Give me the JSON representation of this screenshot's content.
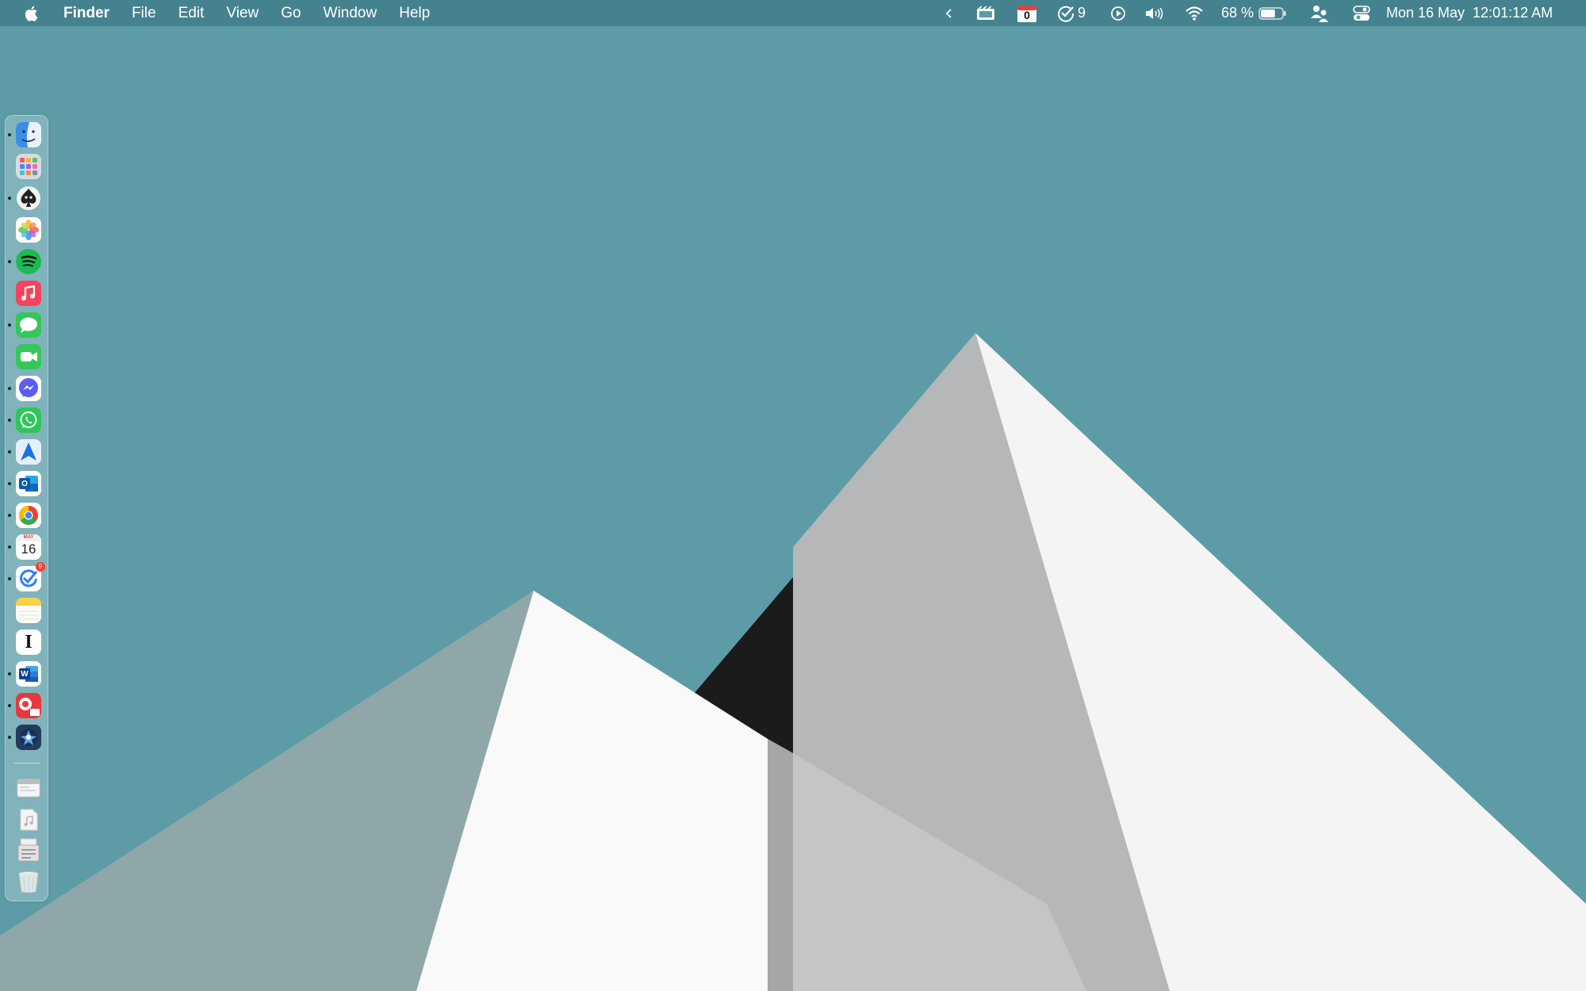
{
  "menubar": {
    "app_name": "Finder",
    "menus": [
      "File",
      "Edit",
      "View",
      "Go",
      "Window",
      "Help"
    ],
    "status": {
      "calendar_badge": "0",
      "reminders_count": "9",
      "battery_percent": "68 %",
      "battery_level": 0.68,
      "date": "Mon 16 May",
      "time": "12:01:12 AM"
    }
  },
  "dock": {
    "apps": [
      {
        "name": "Finder",
        "icon": "finder-icon",
        "running": true
      },
      {
        "name": "Launchpad",
        "icon": "launchpad-icon",
        "running": false
      },
      {
        "name": "Spades",
        "icon": "spade-icon",
        "running": true
      },
      {
        "name": "Photos",
        "icon": "photos-icon",
        "running": false
      },
      {
        "name": "Spotify",
        "icon": "spotify-icon",
        "running": true
      },
      {
        "name": "Music",
        "icon": "music-icon",
        "running": false
      },
      {
        "name": "Messages",
        "icon": "messages-icon",
        "running": true
      },
      {
        "name": "FaceTime",
        "icon": "facetime-icon",
        "running": false
      },
      {
        "name": "Messenger",
        "icon": "messenger-icon",
        "running": true
      },
      {
        "name": "WhatsApp",
        "icon": "whatsapp-icon",
        "running": true
      },
      {
        "name": "Navigation",
        "icon": "navigation-icon",
        "running": true
      },
      {
        "name": "Outlook",
        "icon": "outlook-icon",
        "running": true
      },
      {
        "name": "Chrome",
        "icon": "chrome-icon",
        "running": true
      },
      {
        "name": "Calendar",
        "icon": "calendar-icon",
        "running": true
      },
      {
        "name": "Tasks",
        "icon": "tasks-icon",
        "running": true
      },
      {
        "name": "Notes",
        "icon": "notes-icon",
        "running": false
      },
      {
        "name": "Instapaper",
        "icon": "instapaper-icon",
        "running": false
      },
      {
        "name": "Word",
        "icon": "word-icon",
        "running": true
      },
      {
        "name": "PDF",
        "icon": "pdf-icon",
        "running": true
      },
      {
        "name": "Pixelmator",
        "icon": "pixelmator-icon",
        "running": true
      }
    ],
    "calendar_month": "MAY",
    "calendar_day": "16",
    "tasks_badge": "9",
    "instapaper_glyph": "I",
    "word_glyph": "W",
    "outlook_glyph": "O",
    "stacks": [
      {
        "name": "Browser window",
        "icon": "window-icon"
      },
      {
        "name": "Music file",
        "icon": "music-file-icon"
      },
      {
        "name": "Documents",
        "icon": "documents-icon"
      },
      {
        "name": "Trash",
        "icon": "trash-icon"
      }
    ]
  },
  "colors": {
    "desktop": "#5d9ca6",
    "peak_white": "#f9f9f9",
    "peak_grey": "#b6b7b8",
    "peak_dark": "#1b1b1c"
  }
}
